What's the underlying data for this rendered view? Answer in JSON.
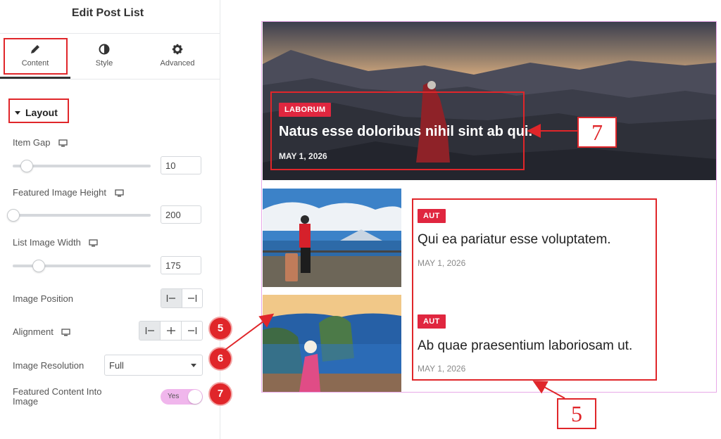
{
  "panel": {
    "title": "Edit Post List",
    "tabs": [
      {
        "label": "Content",
        "icon": "pencil-icon"
      },
      {
        "label": "Style",
        "icon": "contrast-icon"
      },
      {
        "label": "Advanced",
        "icon": "gear-icon"
      }
    ],
    "section": {
      "label": "Layout"
    },
    "controls": {
      "item_gap": {
        "label": "Item Gap",
        "value": "10",
        "slider_fraction": 0.1
      },
      "featured_image_height": {
        "label": "Featured Image Height",
        "value": "200",
        "slider_fraction": 0.0
      },
      "list_image_width": {
        "label": "List Image Width",
        "value": "175",
        "slider_fraction": 0.18
      },
      "image_position": {
        "label": "Image Position",
        "options": [
          "left",
          "right"
        ],
        "selected": "left"
      },
      "alignment": {
        "label": "Alignment",
        "options": [
          "left",
          "center",
          "right"
        ],
        "selected": "left"
      },
      "image_resolution": {
        "label": "Image Resolution",
        "value": "Full"
      },
      "featured_content_into_image": {
        "label": "Featured Content Into Image",
        "toggle_text": "Yes",
        "on": true
      }
    },
    "badges": {
      "alignment": "5",
      "resolution": "6",
      "featured": "7"
    }
  },
  "preview": {
    "featured": {
      "category": "LABORUM",
      "title": "Natus esse doloribus nihil sint ab qui.",
      "date": "MAY 1, 2026"
    },
    "posts": [
      {
        "category": "AUT",
        "title": "Qui ea pariatur esse voluptatem.",
        "date": "MAY 1, 2026"
      },
      {
        "category": "AUT",
        "title": "Ab quae praesentium laboriosam ut.",
        "date": "MAY 1, 2026"
      }
    ],
    "annotations": {
      "featured_callout": "7",
      "list_callout": "5"
    }
  },
  "colors": {
    "accent_red": "#e0262a",
    "category_red": "#e0263f",
    "toggle_pink": "#f0b6ec",
    "preview_border": "#e8a8e8"
  }
}
